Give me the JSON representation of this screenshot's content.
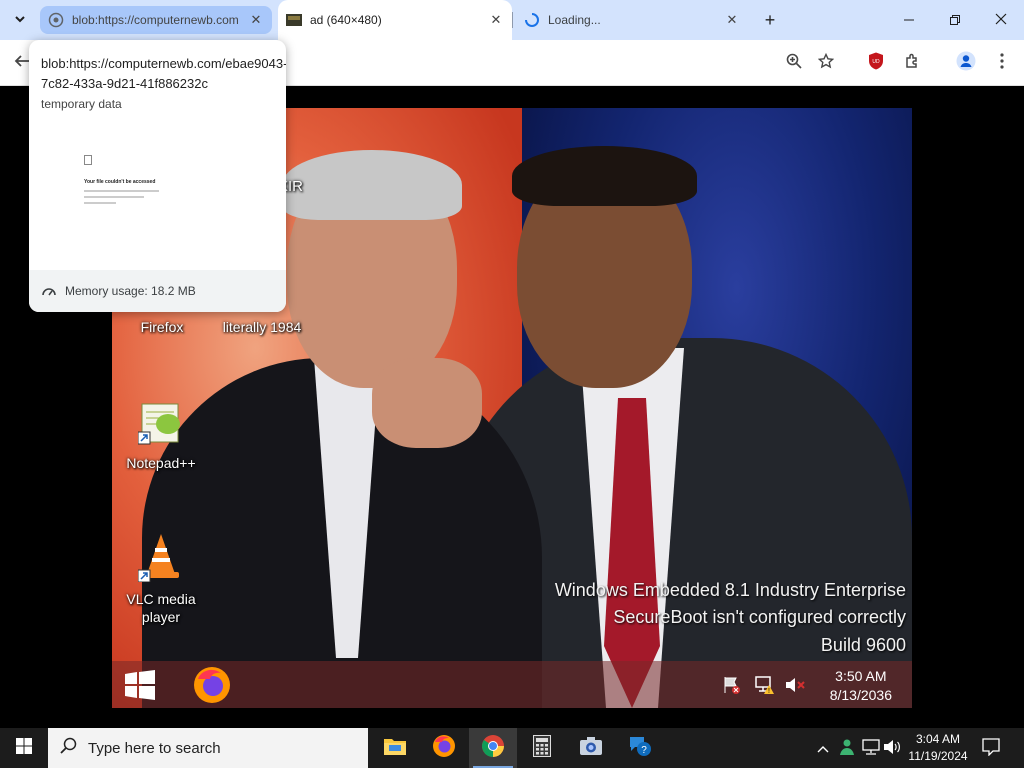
{
  "browser": {
    "tabs": [
      {
        "title": "blob:https://computernewb.com",
        "state": "hovered"
      },
      {
        "title": "ad (640×480)",
        "state": "active"
      },
      {
        "title": "Loading...",
        "state": "loading"
      }
    ],
    "new_tab_symbol": "+",
    "hover_card": {
      "url": "blob:https://computernewb.com/ebae9043-7c82-433a-9d21-41f886232c",
      "subtitle": "temporary data",
      "thumbnail_title": "Your file couldn't be accessed",
      "memory": "Memory usage: 18.2 MB"
    }
  },
  "vm": {
    "desktop_icons": [
      {
        "label": "Firefox"
      },
      {
        "label": "literally 1984"
      },
      {
        "label": "Notepad++"
      },
      {
        "label": "VLC media player"
      }
    ],
    "partial_label": "XIR",
    "watermark": {
      "line1": "Windows Embedded 8.1 Industry Enterprise",
      "line2": "SecureBoot isn't configured correctly",
      "line3": "Build 9600"
    },
    "clock": {
      "time": "3:50 AM",
      "date": "8/13/2036"
    }
  },
  "taskbar": {
    "search_placeholder": "Type here to search",
    "clock": {
      "time": "3:04 AM",
      "date": "11/19/2024"
    }
  },
  "colors": {
    "tabstrip": "#d3e3fd",
    "hover_tab": "#a8c7fa",
    "taskbar": "#1c1c1c",
    "ublock": "#c4161c"
  }
}
